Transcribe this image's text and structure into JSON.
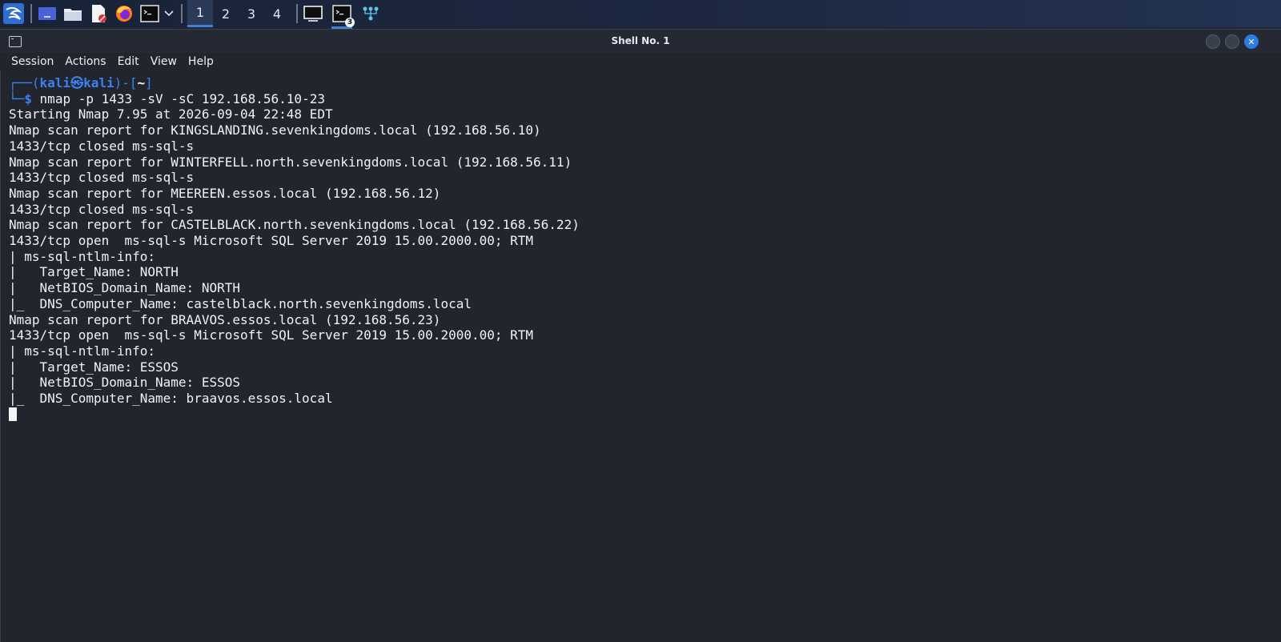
{
  "taskbar": {
    "launchers": [
      {
        "name": "kali-menu-icon"
      },
      {
        "name": "show-desktop-icon"
      },
      {
        "name": "file-manager-icon"
      },
      {
        "name": "text-editor-icon"
      },
      {
        "name": "firefox-icon"
      },
      {
        "name": "terminal-launcher-icon"
      }
    ],
    "workspaces": [
      "1",
      "2",
      "3",
      "4"
    ],
    "active_workspace": "1",
    "terminal_task_count": "3",
    "accent_color": "#3d80d7"
  },
  "window": {
    "title": "Shell No. 1",
    "close_glyph": "✕"
  },
  "menu": [
    "Session",
    "Actions",
    "Edit",
    "View",
    "Help"
  ],
  "terminal": {
    "prompt_user": "kali",
    "prompt_at": "㉿",
    "prompt_host": "kali",
    "prompt_dir": "~",
    "prompt_symbol": "$",
    "command": "nmap -p 1433 -sV -sC 192.168.56.10-23",
    "output": [
      "Starting Nmap 7.95 at 2026-09-04 22:48 EDT",
      "Nmap scan report for KINGSLANDING.sevenkingdoms.local (192.168.56.10)",
      "1433/tcp closed ms-sql-s",
      "Nmap scan report for WINTERFELL.north.sevenkingdoms.local (192.168.56.11)",
      "1433/tcp closed ms-sql-s",
      "Nmap scan report for MEEREEN.essos.local (192.168.56.12)",
      "1433/tcp closed ms-sql-s",
      "Nmap scan report for CASTELBLACK.north.sevenkingdoms.local (192.168.56.22)",
      "1433/tcp open  ms-sql-s Microsoft SQL Server 2019 15.00.2000.00; RTM",
      "| ms-sql-ntlm-info:",
      "|   Target_Name: NORTH",
      "|   NetBIOS_Domain_Name: NORTH",
      "|_  DNS_Computer_Name: castelblack.north.sevenkingdoms.local",
      "Nmap scan report for BRAAVOS.essos.local (192.168.56.23)",
      "1433/tcp open  ms-sql-s Microsoft SQL Server 2019 15.00.2000.00; RTM",
      "| ms-sql-ntlm-info:",
      "|   Target_Name: ESSOS",
      "|   NetBIOS_Domain_Name: ESSOS",
      "|_  DNS_Computer_Name: braavos.essos.local"
    ]
  }
}
